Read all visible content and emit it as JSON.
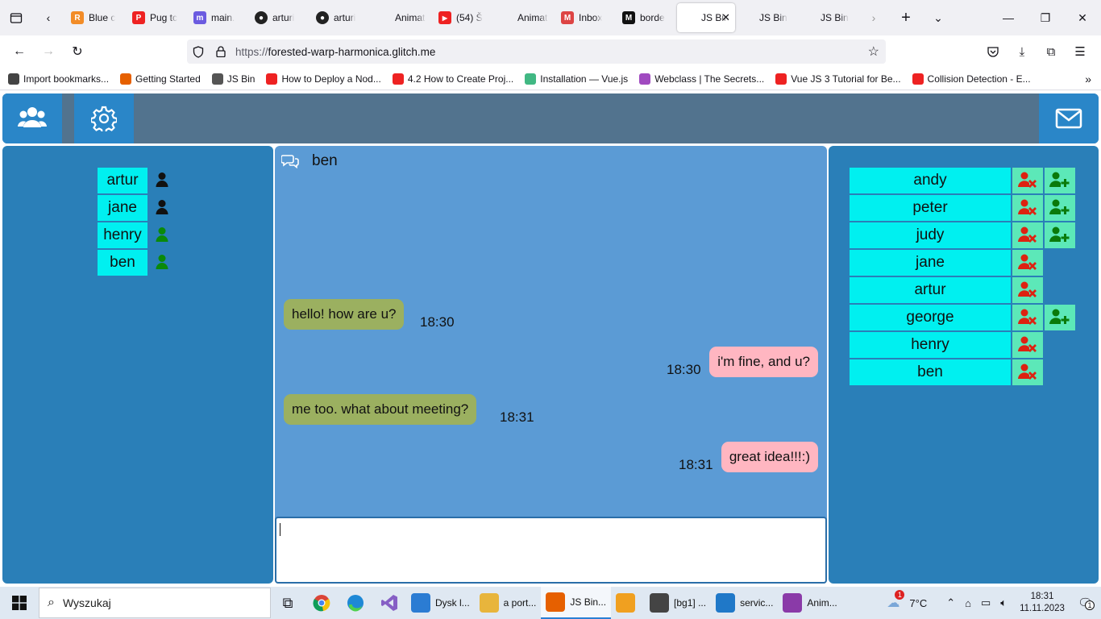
{
  "browser": {
    "tabs": [
      {
        "title": "Blue c",
        "favicon": "R",
        "color": "#f28c28"
      },
      {
        "title": "Pug tc",
        "favicon": "P",
        "color": "#e22"
      },
      {
        "title": "main.",
        "favicon": "m",
        "color": "#6b5be0"
      },
      {
        "title": "arturi",
        "favicon": "gh",
        "color": "#222"
      },
      {
        "title": "arturi",
        "favicon": "gh",
        "color": "#222"
      },
      {
        "title": "Animated",
        "favicon": "",
        "color": "#f0f0f4"
      },
      {
        "title": "(54) Š",
        "favicon": "yt",
        "color": "#e22"
      },
      {
        "title": "Animated",
        "favicon": "",
        "color": "#f0f0f4"
      },
      {
        "title": "Inbox",
        "favicon": "M",
        "color": "#d44"
      },
      {
        "title": "borde",
        "favicon": "M",
        "color": "#111"
      },
      {
        "title": "JS Bin",
        "favicon": "",
        "color": "#fff",
        "active": true
      },
      {
        "title": "JS Bin",
        "favicon": "",
        "color": "#f0f0f4"
      },
      {
        "title": "JS Bin",
        "favicon": "",
        "color": "#f0f0f4"
      }
    ],
    "url_prefix": "https://",
    "url_host": "forested-warp-harmonica.glitch.me",
    "bookmarks": [
      {
        "label": "Import bookmarks...",
        "color": "#444"
      },
      {
        "label": "Getting Started",
        "color": "#e66000"
      },
      {
        "label": "JS Bin",
        "color": "#555"
      },
      {
        "label": "How to Deploy a Nod...",
        "color": "#e22"
      },
      {
        "label": "4.2 How to Create Proj...",
        "color": "#e22"
      },
      {
        "label": "Installation — Vue.js",
        "color": "#41b883"
      },
      {
        "label": "Webclass | The Secrets...",
        "color": "#a04ac0"
      },
      {
        "label": "Vue JS 3 Tutorial for Be...",
        "color": "#e22"
      },
      {
        "label": "Collision Detection - E...",
        "color": "#e22"
      }
    ]
  },
  "app": {
    "colors": {
      "cyan": "#00f0f0",
      "online": "#0a8a0a",
      "offline": "#111111",
      "incoming": "#9bb060",
      "outgoing": "#ffb6c1"
    },
    "contacts": [
      {
        "name": "artur",
        "status": "offline"
      },
      {
        "name": "jane",
        "status": "offline"
      },
      {
        "name": "henry",
        "status": "online"
      },
      {
        "name": "ben",
        "status": "online"
      }
    ],
    "chat": {
      "with": "ben",
      "messages": [
        {
          "text": "hello! how are u?",
          "time": "18:30",
          "dir": "in"
        },
        {
          "text": "i'm fine, and u?",
          "time": "18:30",
          "dir": "out"
        },
        {
          "text": "me too. what about meeting?",
          "time": "18:31",
          "dir": "in"
        },
        {
          "text": "great idea!!!:)",
          "time": "18:31",
          "dir": "out"
        }
      ],
      "input_value": ""
    },
    "users": [
      {
        "name": "andy",
        "can_add": true
      },
      {
        "name": "peter",
        "can_add": true
      },
      {
        "name": "judy",
        "can_add": true
      },
      {
        "name": "jane",
        "can_add": false
      },
      {
        "name": "artur",
        "can_add": false
      },
      {
        "name": "george",
        "can_add": true
      },
      {
        "name": "henry",
        "can_add": false
      },
      {
        "name": "ben",
        "can_add": false
      }
    ]
  },
  "taskbar": {
    "search_placeholder": "Wyszukaj",
    "apps": [
      {
        "label": "Dysk l...",
        "color": "#2b7cd3"
      },
      {
        "label": "a port...",
        "color": "#e8b53c"
      },
      {
        "label": "JS Bin...",
        "color": "#e66000",
        "active": true
      },
      {
        "label": "",
        "color": "#f0a020"
      },
      {
        "label": "[bg1] ...",
        "color": "#444"
      },
      {
        "label": "servic...",
        "color": "#1f78c8"
      },
      {
        "label": "Anim...",
        "color": "#8a3aa8"
      }
    ],
    "weather": "7°C",
    "weather_badge": "1",
    "time": "18:31",
    "date": "11.11.2023",
    "notif_count": "1"
  }
}
